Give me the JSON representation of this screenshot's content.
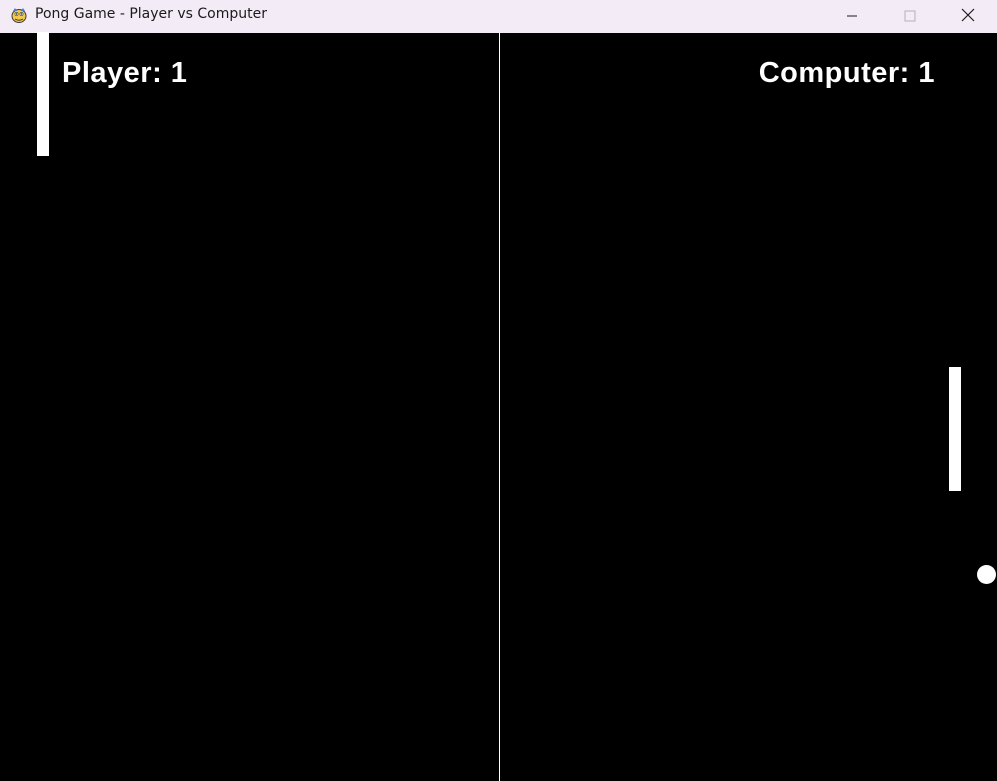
{
  "window": {
    "title": "Pong Game - Player vs Computer",
    "icon": "pygame-snake-icon",
    "controls": [
      "minimize-icon",
      "maximize-icon",
      "close-icon"
    ]
  },
  "game": {
    "player_score_text": "Player: 1",
    "computer_score_text": "Computer: 1",
    "player_score": 1,
    "computer_score": 1,
    "background_color": "#000000",
    "foreground_color": "#ffffff"
  }
}
